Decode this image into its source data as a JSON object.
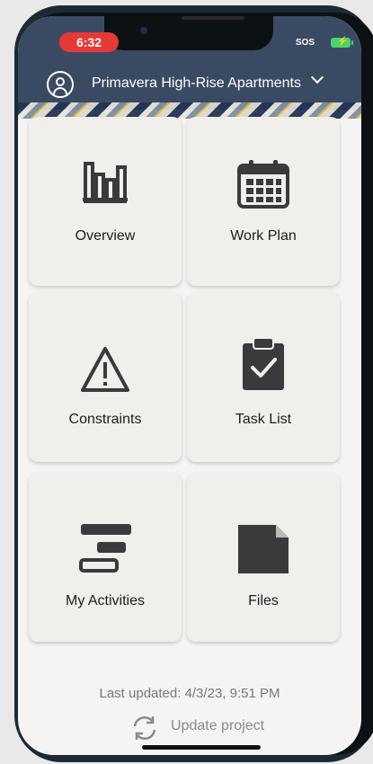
{
  "status_bar": {
    "time": "6:32",
    "sos": "SOS"
  },
  "header": {
    "project_name": "Primavera High-Rise Apartments"
  },
  "tiles": [
    {
      "label": "Overview",
      "icon": "bar-chart-icon"
    },
    {
      "label": "Work Plan",
      "icon": "calendar-icon"
    },
    {
      "label": "Constraints",
      "icon": "warning-icon"
    },
    {
      "label": "Task List",
      "icon": "clipboard-check-icon"
    },
    {
      "label": "My Activities",
      "icon": "activity-bars-icon"
    },
    {
      "label": "Files",
      "icon": "file-icon"
    }
  ],
  "footer": {
    "last_updated": "Last updated: 4/3/23, 9:51 PM",
    "update_button": "Update project"
  },
  "colors": {
    "header_bg": "#3b4a63",
    "time_pill": "#e53935",
    "icon": "#3a3a3a",
    "battery": "#47d46b"
  }
}
